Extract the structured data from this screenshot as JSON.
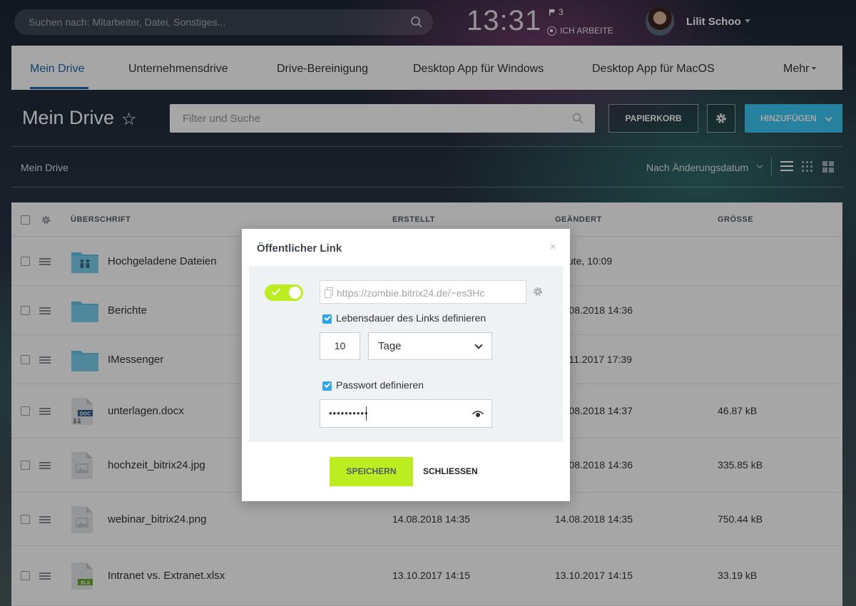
{
  "topbar": {
    "search_placeholder": "Suchen nach: Mitarbeiter, Datei, Sonstiges...",
    "clock": "13:31",
    "flag_count": "3",
    "status": "ICH ARBEITE",
    "user_name": "Lilit Schoo"
  },
  "tabs": [
    {
      "label": "Mein Drive",
      "active": true
    },
    {
      "label": "Unternehmensdrive"
    },
    {
      "label": "Drive-Bereinigung"
    },
    {
      "label": "Desktop App für Windows"
    },
    {
      "label": "Desktop App für MacOS"
    },
    {
      "label": "Mehr"
    }
  ],
  "toolbar": {
    "page_title": "Mein Drive",
    "filter_placeholder": "Filter und Suche",
    "trash_label": "PAPIERKORB",
    "add_label": "HINZUFÜGEN"
  },
  "breadcrumb": "Mein Drive",
  "sort_label": "Nach Änderungsdatum",
  "table": {
    "headers": {
      "name": "ÜBERSCHRIFT",
      "created": "ERSTELLT",
      "changed": "GEÄNDERT",
      "size": "GRÖSSE"
    },
    "rows": [
      {
        "name": "Hochgeladene Dateien",
        "type": "folder-shared",
        "created": "",
        "changed": "Heute, 10:09",
        "size": ""
      },
      {
        "name": "Berichte",
        "type": "folder",
        "created": "",
        "changed": "14.08.2018 14:36",
        "size": ""
      },
      {
        "name": "IMessenger",
        "type": "folder",
        "created": "",
        "changed": "09.11.2017 17:39",
        "size": ""
      },
      {
        "name": "unterlagen.docx",
        "type": "doc",
        "created": "",
        "changed": "14.08.2018 14:37",
        "size": "46.87 kB"
      },
      {
        "name": "hochzeit_bitrix24.jpg",
        "type": "image",
        "created": "",
        "changed": "14.08.2018 14:36",
        "size": "335.85 kB"
      },
      {
        "name": "webinar_bitrix24.png",
        "type": "image",
        "created": "14.08.2018 14:35",
        "changed": "14.08.2018 14:35",
        "size": "750.44 kB"
      },
      {
        "name": "Intranet vs. Extranet.xlsx",
        "type": "xls",
        "created": "13.10.2017 14:15",
        "changed": "13.10.2017 14:15",
        "size": "33.19 kB"
      }
    ]
  },
  "modal": {
    "title": "Öffentlicher Link",
    "close_symbol": "×",
    "link_url": "https://zombie.bitrix24.de/~es3Hc",
    "link_enabled": true,
    "lifetime_label": "Lebensdauer des Links definieren",
    "lifetime_checked": true,
    "lifetime_value": "10",
    "lifetime_unit": "Tage",
    "password_label": "Passwort definieren",
    "password_checked": true,
    "password_mask": "••••••••••",
    "save_label": "SPEICHERN",
    "close_label": "SCHLIESSEN"
  },
  "colors": {
    "accent_blue": "#2067b0",
    "add_button": "#3bc8f5",
    "toggle_green": "#bbed21",
    "checkbox_blue": "#2fa4e7"
  }
}
